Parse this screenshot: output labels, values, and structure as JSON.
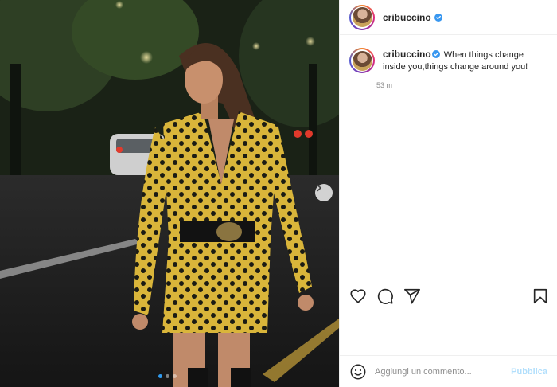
{
  "post": {
    "username": "cribuccino",
    "caption_text": "When things change inside you,things change around you!",
    "timestamp": "53 m",
    "photo_alt": "Woman in yellow polka-dot blazer dress at night"
  },
  "comment": {
    "placeholder": "Aggiungi un commento...",
    "publish_label": "Pubblica"
  },
  "carousel": {
    "total": 3,
    "current": 1
  },
  "colors": {
    "verified": "#3897f0",
    "dot_active": "#2f9bf0",
    "publish_disabled": "#b2dffc"
  },
  "icons": [
    "chevron-right-icon",
    "heart-icon",
    "comment-icon",
    "share-icon",
    "bookmark-icon",
    "emoji-icon",
    "verified-badge-icon"
  ]
}
